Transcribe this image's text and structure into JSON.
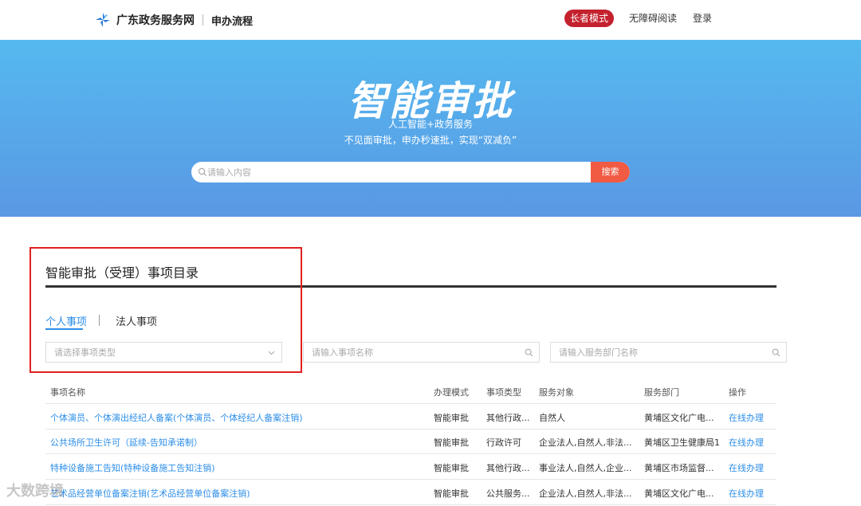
{
  "header": {
    "site_name": "广东政务服务网",
    "section_name": "申办流程",
    "elder_mode": "长者模式",
    "accessibility": "无障碍阅读",
    "login": "登录"
  },
  "banner": {
    "title": "智能审批",
    "subtitle1": "人工智能+政务服务",
    "subtitle2": "不见面审批，申办秒速批，实现“双减负”",
    "search_placeholder": "请输入内容",
    "search_button": "搜索"
  },
  "catalog": {
    "title": "智能审批（受理）事项目录",
    "tabs": [
      "个人事项",
      "法人事项"
    ],
    "active_tab": "个人事项",
    "filters": {
      "type_placeholder": "请选择事项类型",
      "name_placeholder": "请输入事项名称",
      "dept_placeholder": "请输入服务部门名称"
    },
    "columns": [
      "事项名称",
      "办理模式",
      "事项类型",
      "服务对象",
      "服务部门",
      "操作"
    ],
    "rows": [
      [
        "个体演员、个体演出经纪人备案(个体演员、个体经纪人备案注销)",
        "智能审批",
        "其他行政...",
        "自然人",
        "黄埔区文化广电...",
        "在线办理"
      ],
      [
        "公共场所卫生许可（延续-告知承诺制）",
        "智能审批",
        "行政许可",
        "企业法人,自然人,非法...",
        "黄埔区卫生健康局1",
        "在线办理"
      ],
      [
        "特种设备施工告知(特种设备施工告知注销)",
        "智能审批",
        "其他行政...",
        "事业法人,自然人,企业...",
        "黄埔区市场监督...",
        "在线办理"
      ],
      [
        "艺术品经营单位备案注销(艺术品经营单位备案注销)",
        "智能审批",
        "公共服务...",
        "企业法人,自然人,非法...",
        "黄埔区文化广电...",
        "在线办理"
      ]
    ]
  },
  "watermark": "大数跨境",
  "colors": {
    "accent": "#2c8ee8",
    "elder_button": "#c4212e",
    "search_button": "#f15a43",
    "highlight_border": "#e02020"
  }
}
